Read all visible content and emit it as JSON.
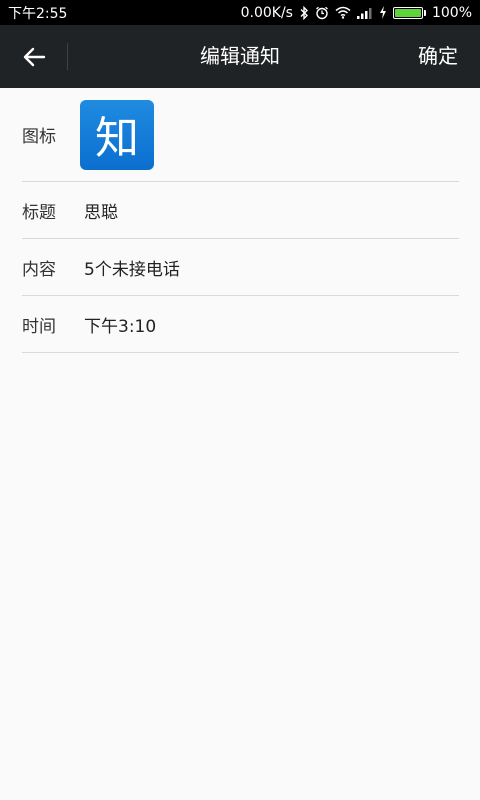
{
  "status_bar": {
    "time": "下午2:55",
    "network_speed": "0.00K/s",
    "battery": "100%",
    "battery_level": 1.0
  },
  "app_bar": {
    "title": "编辑通知",
    "confirm_label": "确定",
    "back_icon": "arrow-left-icon"
  },
  "form": {
    "icon": {
      "label": "图标",
      "icon_glyph": "知",
      "icon_color": "#0b6fd0"
    },
    "title": {
      "label": "标题",
      "value": "思聪"
    },
    "content": {
      "label": "内容",
      "value": "5个未接电话"
    },
    "time": {
      "label": "时间",
      "value": "下午3:10"
    }
  }
}
